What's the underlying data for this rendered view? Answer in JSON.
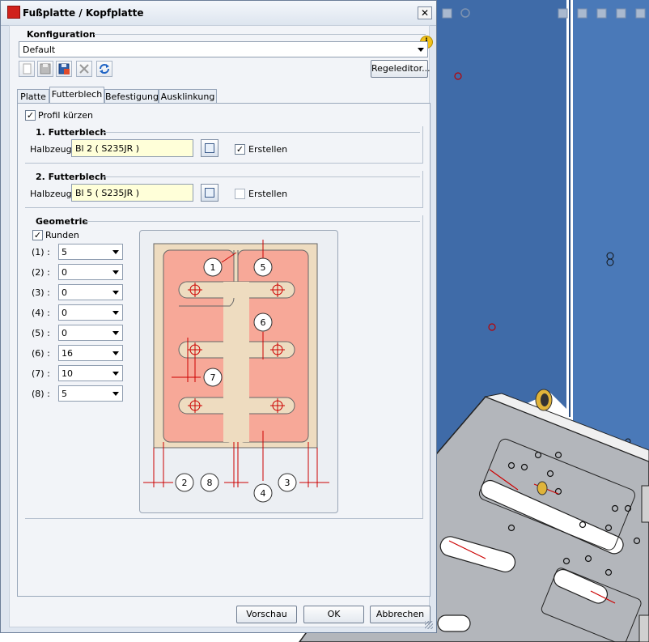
{
  "dialog": {
    "title": "Fußplatte / Kopfplatte",
    "close_symbol": "✕",
    "configuration_label": "Konfiguration",
    "configuration_value": "Default",
    "rules_editor_button": "Regeleditor...",
    "tabs": [
      {
        "label": "Platte",
        "active": false
      },
      {
        "label": "Futterblech",
        "active": true
      },
      {
        "label": "Befestigung",
        "active": false
      },
      {
        "label": "Ausklinkung",
        "active": false
      }
    ],
    "shorten_profile_label": "Profil kürzen",
    "shorten_profile_checked": true,
    "filler1": {
      "title": "1. Futterblech",
      "stock_label": "Halbzeug:",
      "stock_value": "Bl 2  ( S235JR )",
      "create_label": "Erstellen",
      "create_checked": true
    },
    "filler2": {
      "title": "2. Futterblech",
      "stock_label": "Halbzeug:",
      "stock_value": "Bl 5  ( S235JR )",
      "create_label": "Erstellen",
      "create_checked": false
    },
    "geometry": {
      "title": "Geometrie",
      "round_label": "Runden",
      "round_checked": true,
      "params": [
        {
          "label": "(1) :",
          "value": "5"
        },
        {
          "label": "(2) :",
          "value": "0"
        },
        {
          "label": "(3) :",
          "value": "0"
        },
        {
          "label": "(4) :",
          "value": "0"
        },
        {
          "label": "(5) :",
          "value": "0"
        },
        {
          "label": "(6) :",
          "value": "16"
        },
        {
          "label": "(7) :",
          "value": "10"
        },
        {
          "label": "(8) :",
          "value": "5"
        }
      ],
      "diagram_markers": [
        "1",
        "5",
        "6",
        "7",
        "2",
        "8",
        "4",
        "3"
      ]
    },
    "buttons": {
      "preview": "Vorschau",
      "ok": "OK",
      "cancel": "Abbrechen"
    }
  },
  "colors": {
    "viewport_blue": "#3e6aa6",
    "plate_fill": "#f7a898",
    "base_fill": "#eed9bf",
    "accent_red": "#cc0000"
  }
}
